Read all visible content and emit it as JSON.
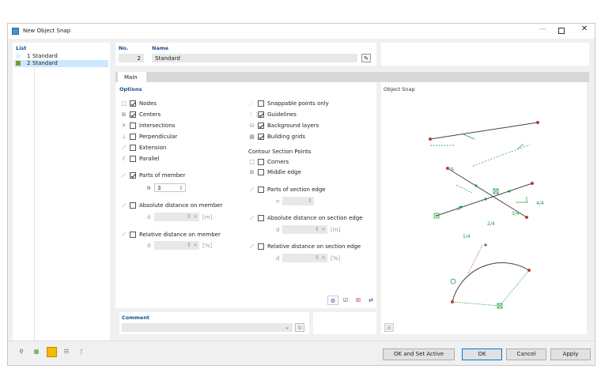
{
  "window": {
    "title": "New Object Snap"
  },
  "list": {
    "header": "List",
    "items": [
      {
        "num": "1",
        "name": "Standard",
        "color": "#e3f3ff"
      },
      {
        "num": "2",
        "name": "Standard",
        "color": "#7c9a2c"
      }
    ]
  },
  "record": {
    "no_label": "No.",
    "no_value": "2",
    "name_label": "Name",
    "name_value": "Standard"
  },
  "tabs": {
    "main": "Main"
  },
  "options": {
    "header": "Options",
    "left": [
      {
        "label": "Nodes",
        "checked": true
      },
      {
        "label": "Centers",
        "checked": true
      },
      {
        "label": "Intersections",
        "checked": false
      },
      {
        "label": "Perpendicular",
        "checked": false
      },
      {
        "label": "Extension",
        "checked": false
      },
      {
        "label": "Parallel",
        "checked": false
      }
    ],
    "parts_of_member": {
      "label": "Parts of member",
      "checked": true,
      "n_label": "n",
      "n_value": "3"
    },
    "abs_member": {
      "label": "Absolute distance on member",
      "d_label": "d",
      "unit": "[m]"
    },
    "rel_member": {
      "label": "Relative distance on member",
      "d_label": "d",
      "unit": "[%]"
    },
    "right": [
      {
        "label": "Snappable points only",
        "checked": false
      },
      {
        "label": "Guidelines",
        "checked": true
      },
      {
        "label": "Background layers",
        "checked": true
      },
      {
        "label": "Building grids",
        "checked": true
      }
    ],
    "contour_header": "Contour Section Points",
    "contour": [
      {
        "label": "Corners",
        "checked": false
      },
      {
        "label": "Middle edge",
        "checked": false
      }
    ],
    "parts_section": {
      "label": "Parts of section edge",
      "n_label": "n"
    },
    "abs_section": {
      "label": "Absolute distance on section edge",
      "d_label": "d",
      "unit": "[m]"
    },
    "rel_section": {
      "label": "Relative distance on section edge",
      "d_label": "d",
      "unit": "[%]"
    }
  },
  "preview": {
    "header": "Object Snap",
    "labels": {
      "quarter1": "1/4",
      "quarter2": "2/4",
      "quarter3": "3/4",
      "quarter4": "4/4",
      "d": "d",
      "pct": "%"
    }
  },
  "comment": {
    "header": "Comment"
  },
  "buttons": {
    "ok_active": "OK and Set Active",
    "ok": "OK",
    "cancel": "Cancel",
    "apply": "Apply"
  },
  "colors": {
    "accent": "#1a4f8a",
    "snap_green": "#1e9a3c",
    "snap_red": "#c0392b",
    "selected": "#cce8ff"
  }
}
